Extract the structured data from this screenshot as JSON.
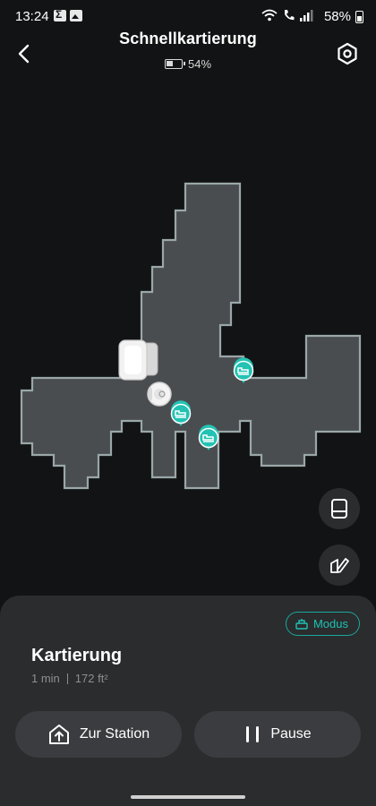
{
  "status_bar": {
    "time": "13:24",
    "battery": "58%"
  },
  "header": {
    "title": "Schnellkartierung",
    "robot_battery": "54%"
  },
  "map": {
    "floor_color": "#4a4d50",
    "wall_color": "#9aa7a8",
    "marker_color": "#23c2b3"
  },
  "panel": {
    "mode_label": "Modus",
    "title": "Kartierung",
    "duration": "1 min",
    "area": "172 ft²",
    "station_label": "Zur Station",
    "pause_label": "Pause"
  }
}
